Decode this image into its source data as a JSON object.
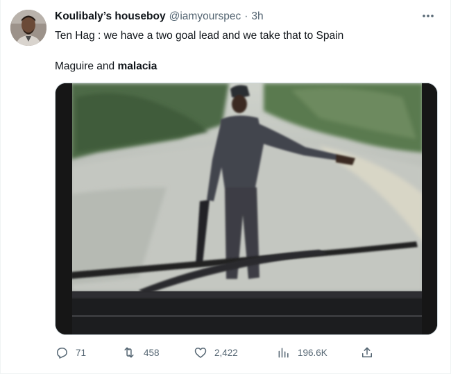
{
  "tweet": {
    "display_name": "Koulibaly’s houseboy",
    "handle": "@iamyourspec",
    "separator": "·",
    "time": "3h",
    "line1": "Ten Hag : we have a two goal lead and we take that to Spain",
    "line2_prefix": "Maguire and ",
    "line2_bold": "malacia"
  },
  "actions": {
    "replies": "71",
    "retweets": "458",
    "likes": "2,422",
    "views": "196.6K"
  },
  "icons": {
    "more": "more-horizontal-icon",
    "reply": "reply-icon",
    "retweet": "retweet-icon",
    "like": "heart-icon",
    "views": "views-bar-chart-icon",
    "share": "share-icon"
  },
  "colors": {
    "text": "#0f1419",
    "secondary": "#536471",
    "border": "#cfd9de"
  }
}
